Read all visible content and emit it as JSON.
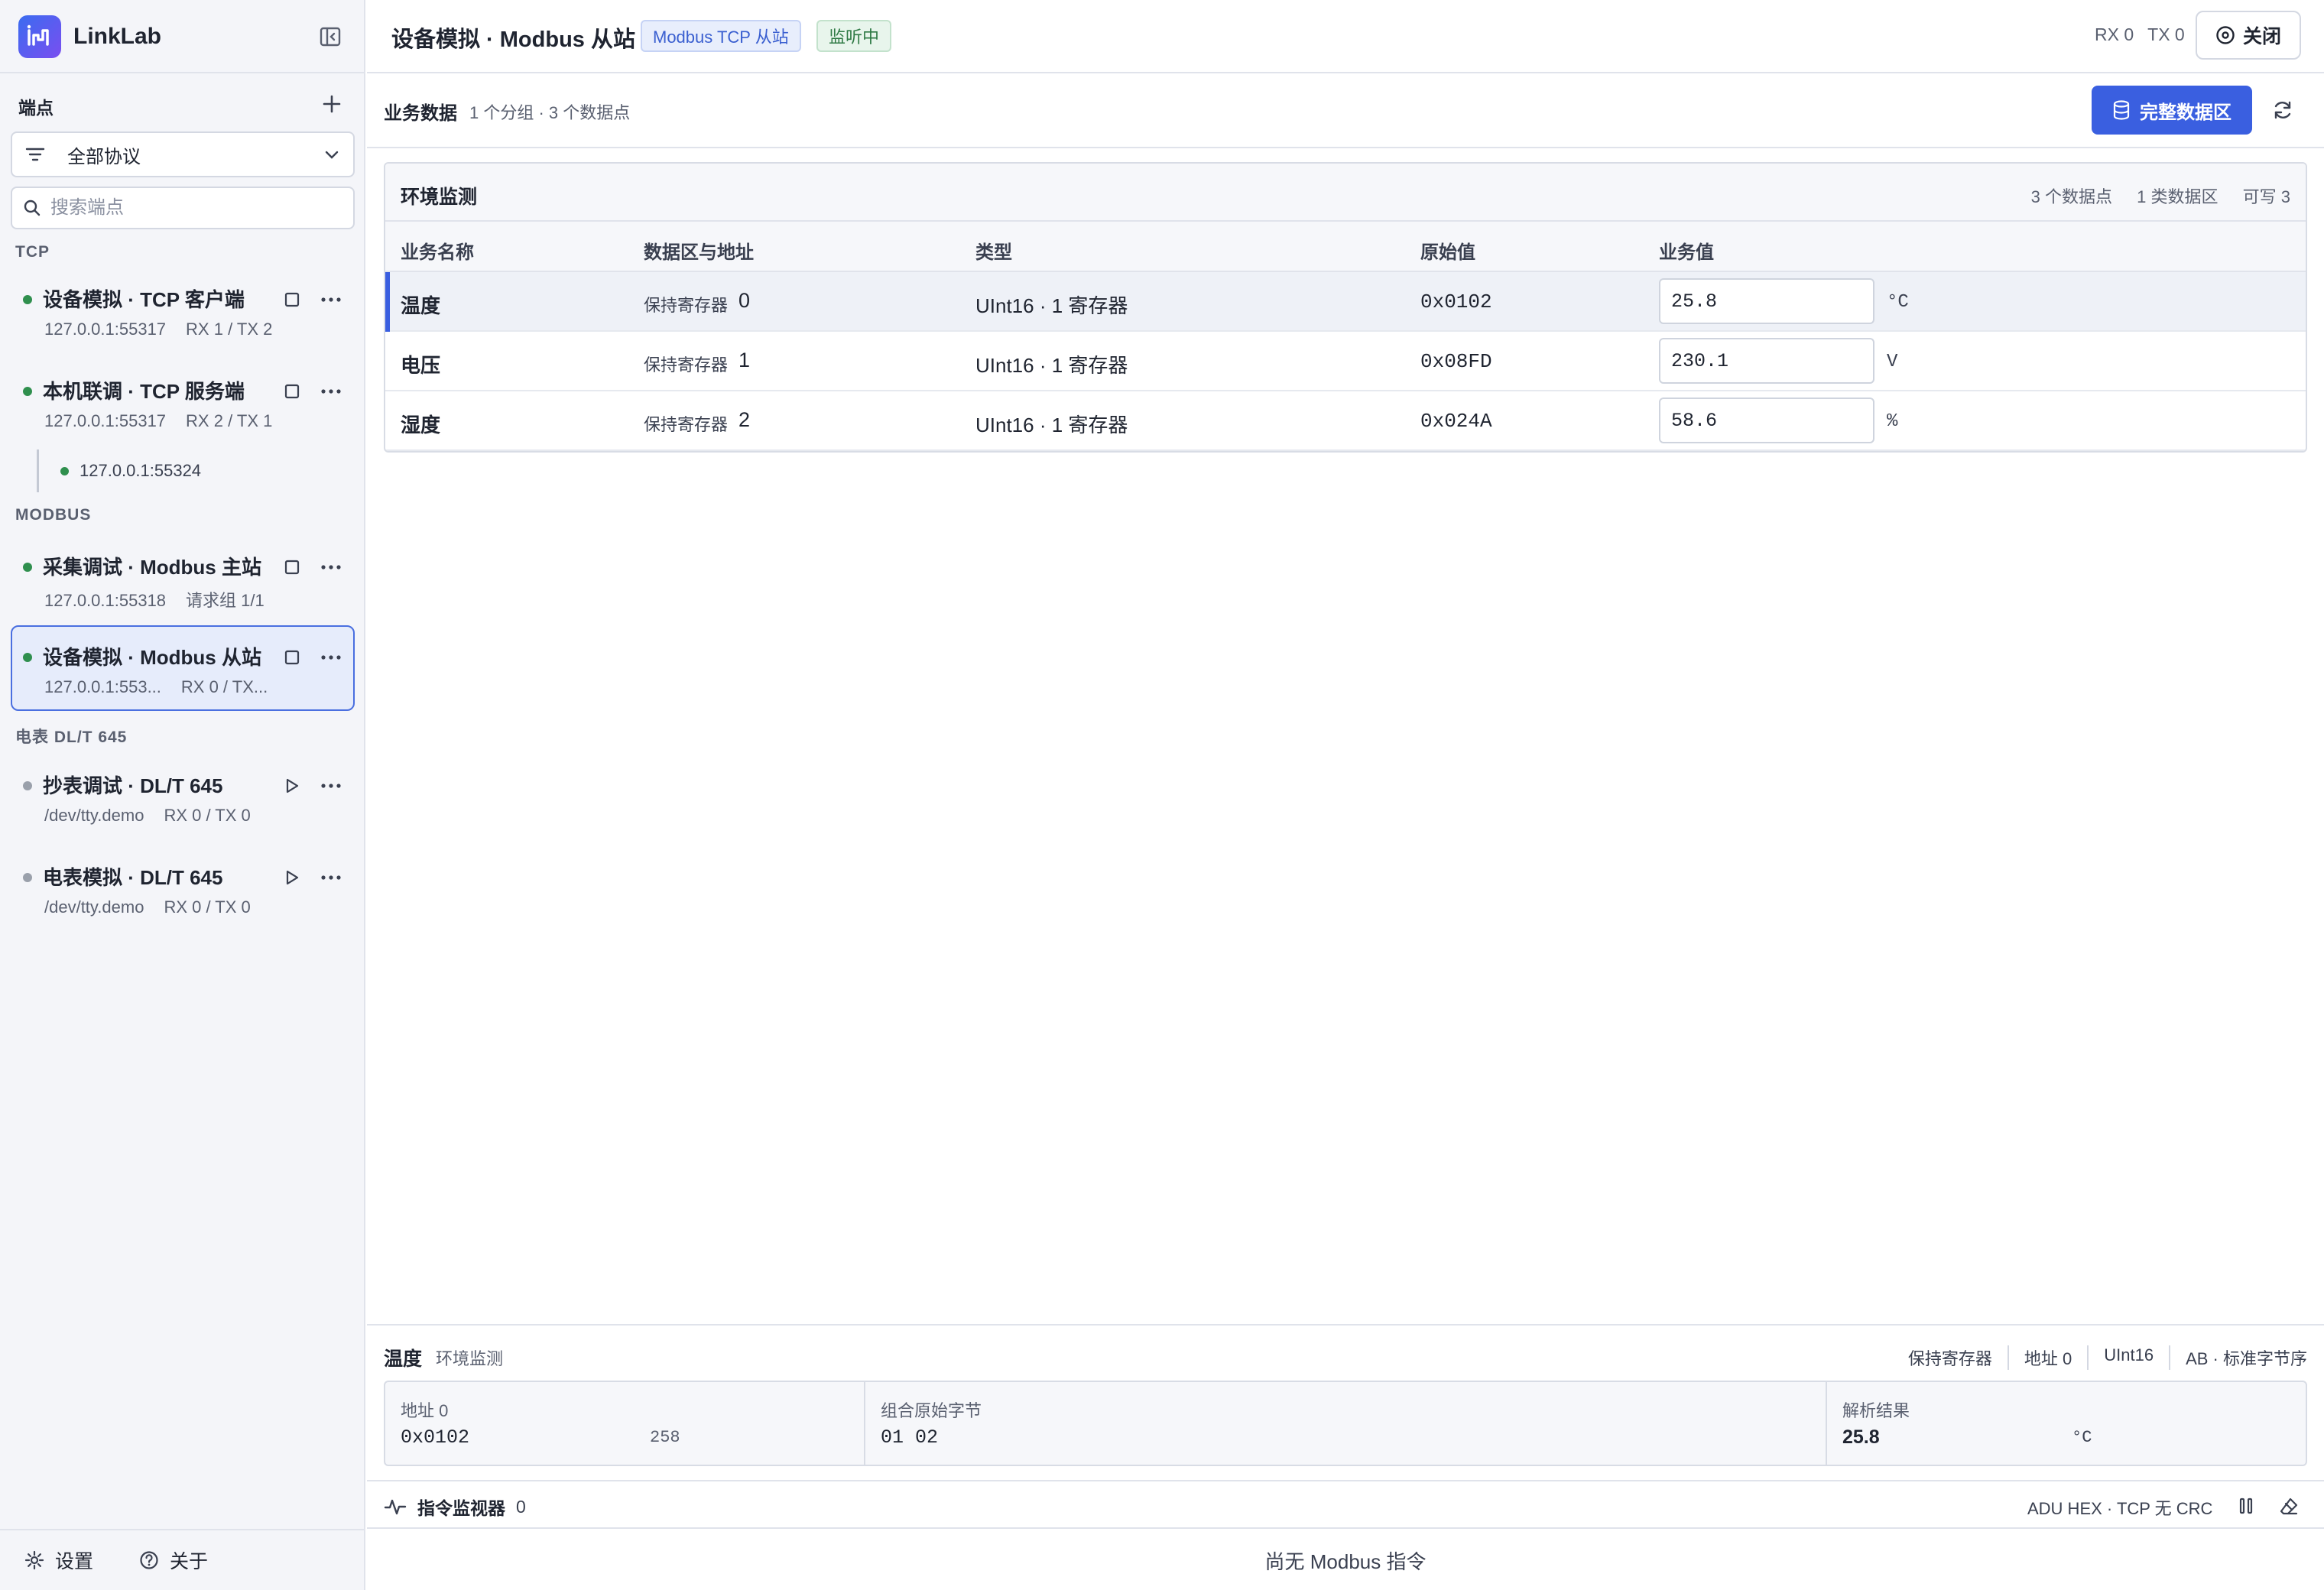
{
  "app": {
    "name": "LinkLab",
    "logo_text": "ılı"
  },
  "sidebar": {
    "section_title": "端点",
    "protocol_filter": "全部协议",
    "search_placeholder": "搜索端点",
    "groups": [
      {
        "title": "TCP"
      },
      {
        "title": "MODBUS"
      },
      {
        "title": "电表 DL/T 645"
      }
    ],
    "endpoints": [
      {
        "name": "设备模拟 · TCP 客户端",
        "addr": "127.0.0.1:55317",
        "stats": "RX 1 / TX 2",
        "status": "running"
      },
      {
        "name": "本机联调 · TCP 服务端",
        "addr": "127.0.0.1:55317",
        "stats": "RX 2 / TX 1",
        "status": "running"
      },
      {
        "name": "采集调试 · Modbus 主站",
        "addr": "127.0.0.1:55318",
        "stats": "请求组 1/1",
        "status": "running"
      },
      {
        "name": "设备模拟 · Modbus 从站",
        "addr": "127.0.0.1:553...",
        "stats": "RX 0 / TX...",
        "status": "running",
        "active": true
      },
      {
        "name": "抄表调试 · DL/T 645",
        "addr": "/dev/tty.demo",
        "stats": "RX 0 / TX 0",
        "status": "stopped"
      },
      {
        "name": "电表模拟 · DL/T 645",
        "addr": "/dev/tty.demo",
        "stats": "RX 0 / TX 0",
        "status": "stopped"
      }
    ],
    "client_connection": "127.0.0.1:55324",
    "footer": {
      "settings": "设置",
      "about": "关于"
    }
  },
  "header": {
    "title": "设备模拟 · Modbus 从站",
    "protocol_badge": "Modbus TCP 从站",
    "status_badge": "监听中",
    "rx": "RX 0",
    "tx": "TX 0",
    "close_label": "关闭"
  },
  "biz": {
    "title": "业务数据",
    "meta": "1 个分组 · 3 个数据点",
    "full_button": "完整数据区"
  },
  "panel": {
    "title": "环境监测",
    "stats": [
      "3 个数据点",
      "1 类数据区",
      "可写 3"
    ],
    "columns": [
      "业务名称",
      "数据区与地址",
      "类型",
      "原始值",
      "业务值"
    ],
    "rows": [
      {
        "name": "温度",
        "area": "保持寄存器",
        "addr": "0",
        "type": "UInt16 · 1 寄存器",
        "raw": "0x0102",
        "value": "25.8",
        "unit": "°C",
        "selected": true
      },
      {
        "name": "电压",
        "area": "保持寄存器",
        "addr": "1",
        "type": "UInt16 · 1 寄存器",
        "raw": "0x08FD",
        "value": "230.1",
        "unit": "V"
      },
      {
        "name": "湿度",
        "area": "保持寄存器",
        "addr": "2",
        "type": "UInt16 · 1 寄存器",
        "raw": "0x024A",
        "value": "58.6",
        "unit": "%"
      }
    ]
  },
  "detail": {
    "name": "温度",
    "group": "环境监测",
    "tags": [
      "保持寄存器",
      "地址 0",
      "UInt16",
      "AB · 标准字节序"
    ],
    "address_label": "地址 0",
    "address_hex": "0x0102",
    "address_dec": "258",
    "bytes_label": "组合原始字节",
    "bytes_value": "01 02",
    "result_label": "解析结果",
    "result_value": "25.8",
    "result_unit": "°C"
  },
  "monitor": {
    "title": "指令监视器",
    "count": "0",
    "mode": "ADU HEX · TCP 无 CRC",
    "empty_text": "尚无 Modbus 指令"
  },
  "colors": {
    "accent": "#3a5fe0",
    "running": "#2f8f4e",
    "stopped": "#9aa0ab"
  }
}
